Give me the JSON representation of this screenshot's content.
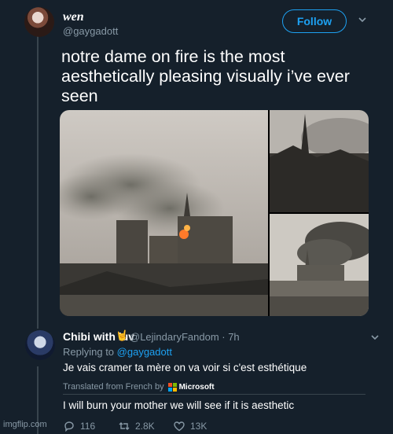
{
  "tweet": {
    "display_name": "wen",
    "handle": "@gaygadott",
    "follow_label": "Follow",
    "text": "notre dame on fire is the most aesthetically pleasing visually i’ve ever seen"
  },
  "reply": {
    "display_name": "Chibi with luv",
    "name_emoji": "🤘",
    "handle_time": "@LejindaryFandom · 7h",
    "replying_to_label": "Replying to",
    "replying_to_handle": "@gaygadott",
    "text": "Je vais cramer ta mère on va voir si c'est esthétique",
    "translated_label": "Translated from French by",
    "translator": "Microsoft",
    "translation": "I will burn your mother we will see if it is aesthetic",
    "stats": {
      "replies": "116",
      "retweets": "2.8K",
      "likes": "13K"
    }
  },
  "watermark": "imgflip.com",
  "colors": {
    "background": "#15202b",
    "accent": "#1da1f2",
    "muted": "#8899a6",
    "border": "#38444d"
  },
  "icons": [
    "chevron-down-icon",
    "reply-icon",
    "retweet-icon",
    "like-icon",
    "microsoft-logo-icon"
  ]
}
